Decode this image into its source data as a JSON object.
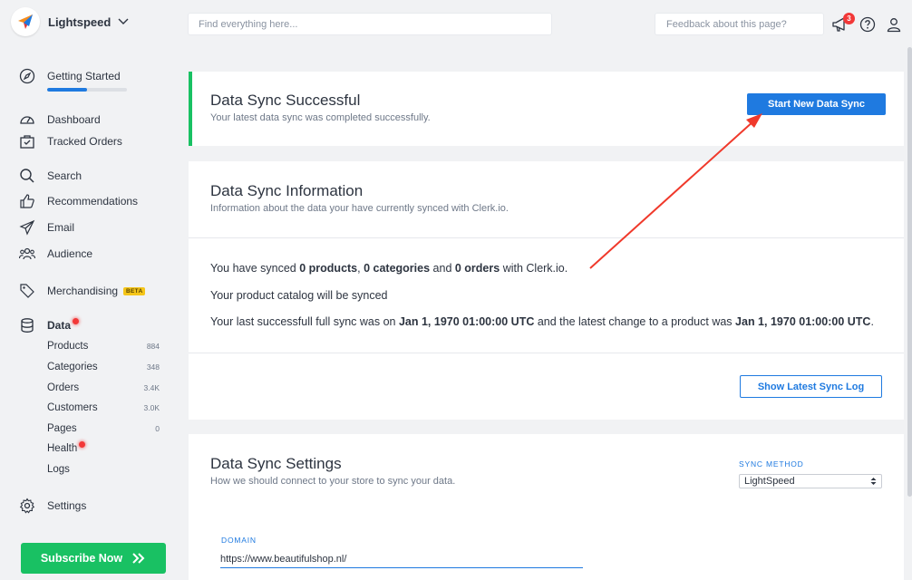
{
  "brand": {
    "name": "Lightspeed"
  },
  "search": {
    "placeholder": "Find everything here..."
  },
  "feedback": {
    "placeholder": "Feedback about this page?"
  },
  "notifications": {
    "count": "3"
  },
  "sidebar": {
    "getting_started": {
      "label": "Getting Started",
      "progress": 0.5
    },
    "items": [
      {
        "label": "Dashboard",
        "icon": "dashboard-icon"
      },
      {
        "label": "Tracked Orders",
        "icon": "tracked-orders-icon"
      },
      {
        "label": "Search",
        "icon": "search-icon"
      },
      {
        "label": "Recommendations",
        "icon": "thumbs-up-icon"
      },
      {
        "label": "Email",
        "icon": "paper-plane-icon"
      },
      {
        "label": "Audience",
        "icon": "audience-icon"
      },
      {
        "label": "Merchandising",
        "icon": "tag-icon",
        "badge": "BETA"
      },
      {
        "label": "Data",
        "icon": "database-icon"
      }
    ],
    "data_sub": [
      {
        "label": "Products",
        "count": "884"
      },
      {
        "label": "Categories",
        "count": "348"
      },
      {
        "label": "Orders",
        "count": "3.4K"
      },
      {
        "label": "Customers",
        "count": "3.0K"
      },
      {
        "label": "Pages",
        "count": "0"
      },
      {
        "label": "Health",
        "count": ""
      },
      {
        "label": "Logs",
        "count": ""
      }
    ],
    "settings": {
      "label": "Settings"
    },
    "subscribe": {
      "label": "Subscribe Now"
    }
  },
  "success": {
    "title": "Data Sync Successful",
    "subtitle": "Your latest data sync was completed successfully.",
    "button": "Start New Data Sync"
  },
  "info": {
    "title": "Data Sync Information",
    "subtitle": "Information about the data your have currently synced with Clerk.io.",
    "line1": {
      "pre": "You have synced ",
      "products": "0 products",
      "sep1": ", ",
      "categories": "0 categories",
      "sep2": " and ",
      "orders": "0 orders",
      "post": " with Clerk.io."
    },
    "line2": "Your product catalog will be synced",
    "line3": {
      "pre": "Your last successfull full sync was on ",
      "date1": "Jan 1, 1970 01:00:00 UTC",
      "mid": " and the latest change to a product was ",
      "date2": "Jan 1, 1970 01:00:00 UTC",
      "post": "."
    },
    "log_button": "Show Latest Sync Log"
  },
  "settings_card": {
    "title": "Data Sync Settings",
    "subtitle": "How we should connect to your store to sync your data.",
    "sync_method_label": "SYNC METHOD",
    "sync_method_value": "LightSpeed",
    "domain_label": "DOMAIN",
    "domain_value": "https://www.beautifulshop.nl/"
  },
  "colors": {
    "accent": "#1f7ae0",
    "success": "#19c163",
    "alert": "#f23838",
    "annotation_arrow": "#f0392b"
  }
}
